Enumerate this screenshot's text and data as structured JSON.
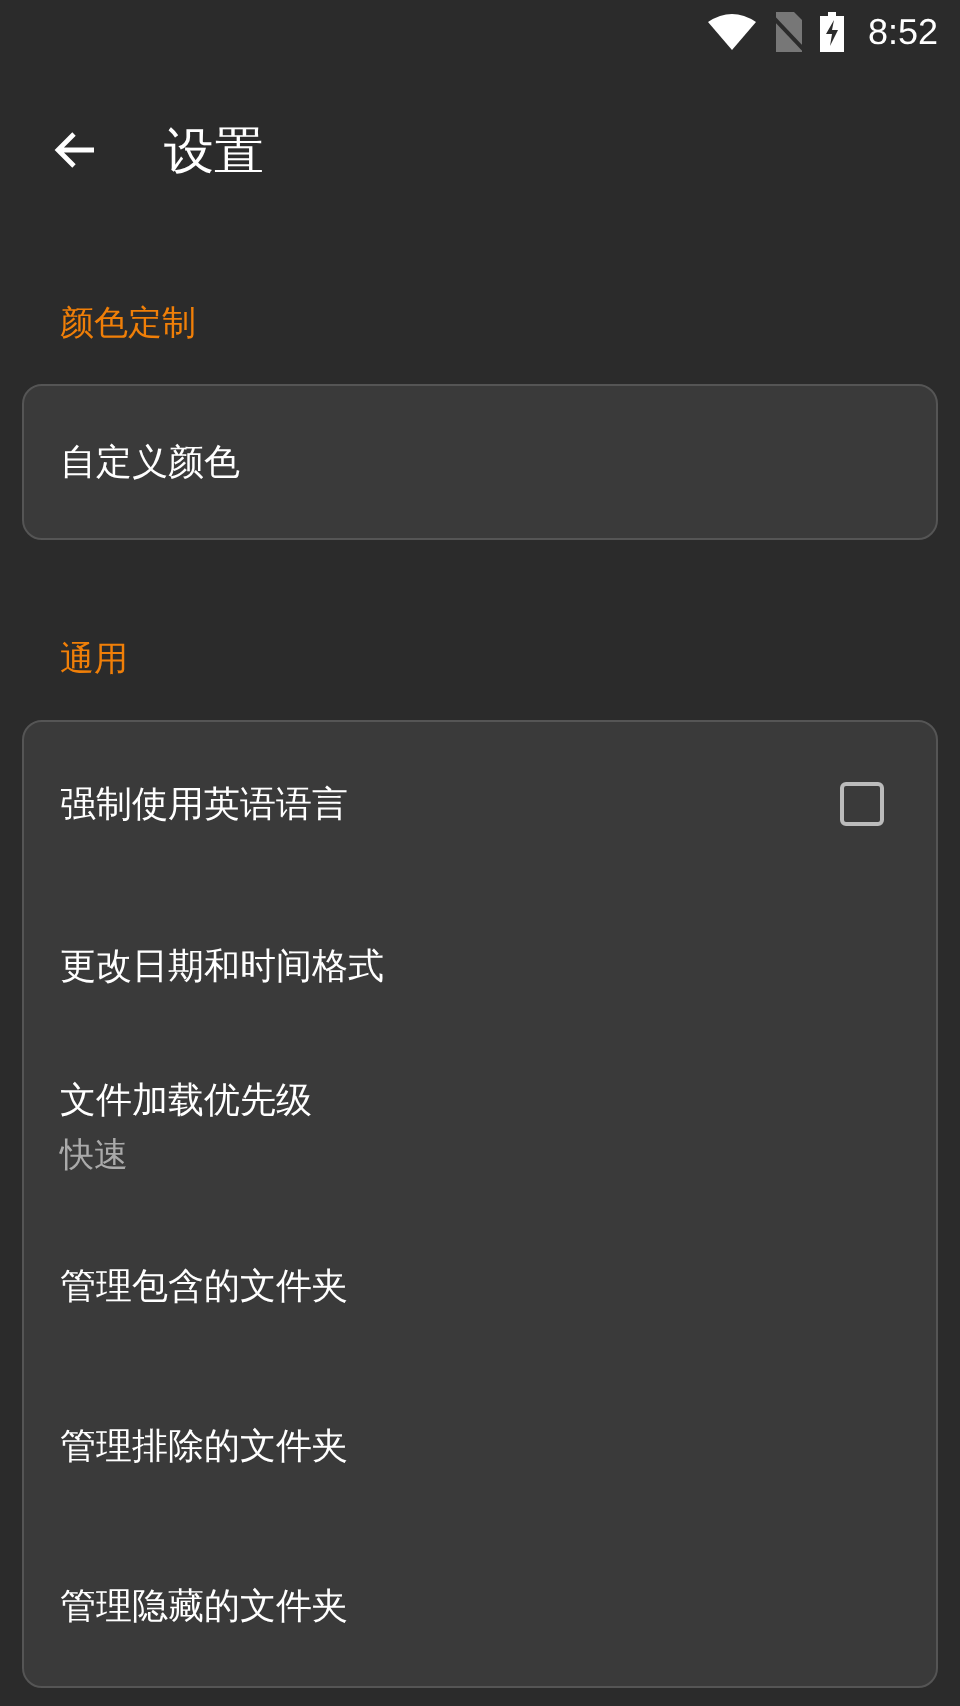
{
  "status_bar": {
    "time": "8:52"
  },
  "app_bar": {
    "title": "设置"
  },
  "sections": [
    {
      "header": "颜色定制",
      "items": [
        {
          "kind": "plain",
          "label": "自定义颜色"
        }
      ]
    },
    {
      "header": "通用",
      "items": [
        {
          "kind": "checkbox",
          "label": "强制使用英语语言",
          "checked": false
        },
        {
          "kind": "plain",
          "label": "更改日期和时间格式"
        },
        {
          "kind": "value",
          "label": "文件加载优先级",
          "value": "快速"
        },
        {
          "kind": "plain",
          "label": "管理包含的文件夹"
        },
        {
          "kind": "plain",
          "label": "管理排除的文件夹"
        },
        {
          "kind": "plain",
          "label": "管理隐藏的文件夹"
        }
      ]
    }
  ]
}
